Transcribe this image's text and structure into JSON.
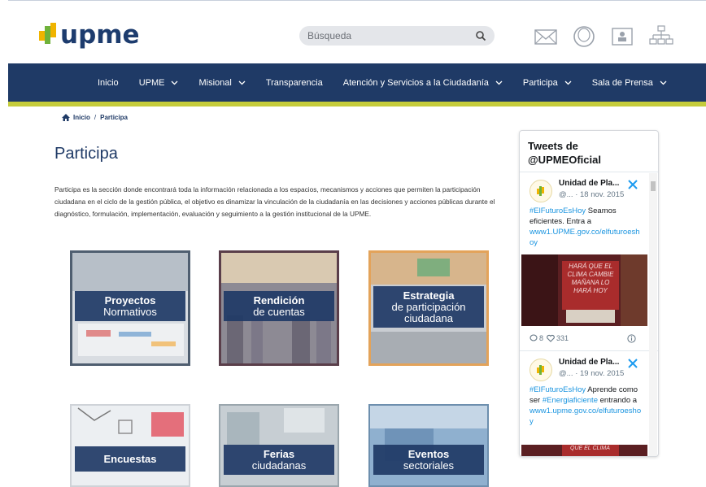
{
  "header": {
    "logo_text": "upme",
    "search": {
      "placeholder": "Búsqueda"
    },
    "icons": [
      "mail-icon",
      "user-circle-icon",
      "contact-card-icon",
      "sitemap-icon"
    ]
  },
  "nav": {
    "items": [
      {
        "label": "Inicio",
        "has_dropdown": false
      },
      {
        "label": "UPME",
        "has_dropdown": true
      },
      {
        "label": "Misional",
        "has_dropdown": true
      },
      {
        "label": "Transparencia",
        "has_dropdown": false
      },
      {
        "label": "Atención y Servicios a la Ciudadanía",
        "has_dropdown": true
      },
      {
        "label": "Participa",
        "has_dropdown": true
      },
      {
        "label": "Sala de Prensa",
        "has_dropdown": true
      }
    ]
  },
  "breadcrumb": {
    "home": "Inicio",
    "separator": "/",
    "current": "Participa"
  },
  "page": {
    "title": "Participa",
    "description": "Participa es la sección donde encontrará toda la información relacionada a los espacios, mecanismos y acciones que permiten la participación ciudadana en el ciclo de la gestión pública, el objetivo es dinamizar la vinculación de la ciudadanía en las decisiones y acciones públicas durante el diagnóstico, formulación, implementación, evaluación y seguimiento a la gestión institucional de la UPME."
  },
  "tiles": [
    {
      "line1": "Proyectos",
      "line2": "Normativos"
    },
    {
      "line1": "Rendición",
      "line2": "de cuentas"
    },
    {
      "line1": "Estrategia",
      "line2": "de participación",
      "line3": "ciudadana"
    },
    {
      "line1": "Encuestas"
    },
    {
      "line1": "Ferias",
      "line2": "ciudadanas"
    },
    {
      "line1": "Eventos",
      "line2": "sectoriales"
    }
  ],
  "tweets": {
    "title_line1": "Tweets de",
    "title_line2": "@UPMEOficial",
    "items": [
      {
        "name": "Unidad de Pla...",
        "handle": "@... · 18 nov. 2015",
        "hashtag": "#ElFuturoEsHoy",
        "text": " Seamos eficientes. Entra a",
        "link": "www1.UPME.gov.co/elfuturoeshoy",
        "image_text": "HARÁ QUE EL CLIMA CAMBIE MAÑANA LO HARÁ HOY",
        "replies": "8",
        "likes": "331"
      },
      {
        "name": "Unidad de Pla...",
        "handle": "@... · 19 nov. 2015",
        "hashtag": "#ElFuturoEsHoy",
        "text": " Aprende como ser ",
        "hashtag2": "#Energiaficiente",
        "text2": " entrando a",
        "link": "www1.upme.gov.co/elfuturoeshoy",
        "image_text": "QUE EL CLIMA"
      }
    ]
  }
}
